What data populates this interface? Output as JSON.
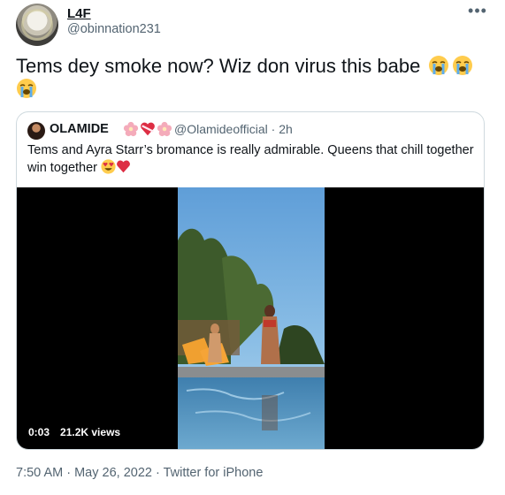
{
  "tweet": {
    "author_name": "L4F",
    "author_handle": "@obinnation231",
    "text": "Tems dey smoke now? Wiz don virus this babe",
    "emoji": [
      "loudly-crying-face",
      "loudly-crying-face",
      "loudly-crying-face"
    ],
    "more_icon": "more-horizontal-icon",
    "meta": "7:50 AM · May 26, 2022 · Twitter for iPhone"
  },
  "quoted_tweet": {
    "author_name": "OLAMIDE",
    "name_emoji": [
      "cherry-blossom",
      "heart-with-ribbon",
      "cherry-blossom"
    ],
    "handle_time": "@Olamideofficial · 2h",
    "text": "Tems and Ayra Starr’s bromance is really admirable. Queens that chill together win together",
    "text_emoji": [
      "heart-eyes-face",
      "red-heart"
    ],
    "video": {
      "duration": "0:03",
      "views": "21.2K views"
    }
  },
  "colors": {
    "text_primary": "#0f1419",
    "text_secondary": "#536471",
    "border": "#cfd9de",
    "media_bg": "#000000"
  }
}
